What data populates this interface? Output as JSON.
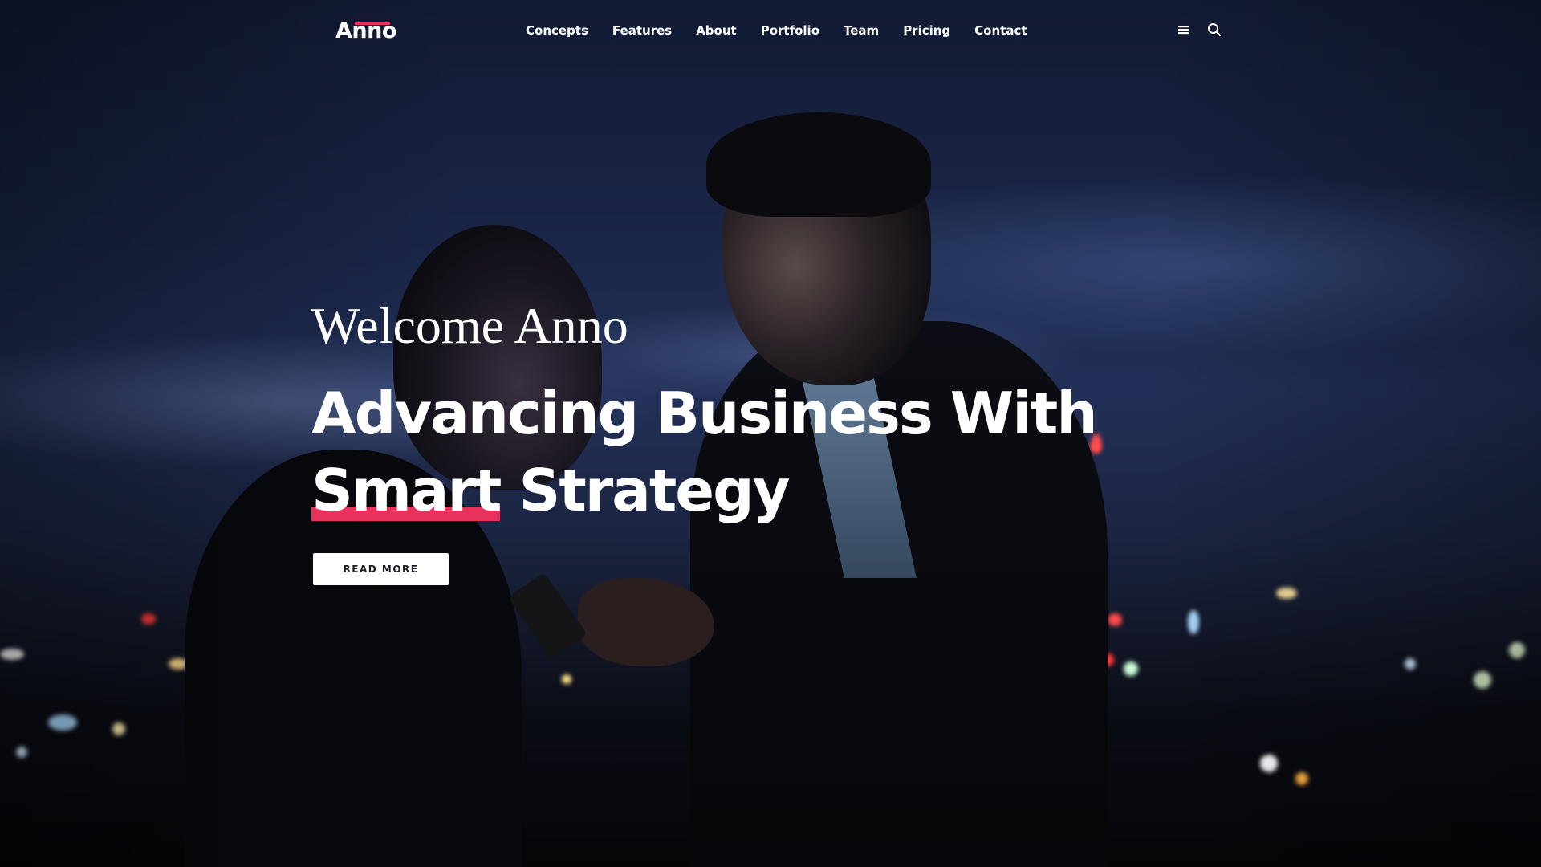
{
  "brand": {
    "logo_text": "Anno",
    "accent_color": "#e8315b"
  },
  "nav": {
    "items": [
      {
        "label": "Concepts"
      },
      {
        "label": "Features"
      },
      {
        "label": "About"
      },
      {
        "label": "Portfolio"
      },
      {
        "label": "Team"
      },
      {
        "label": "Pricing"
      },
      {
        "label": "Contact"
      }
    ],
    "icons": [
      "menu-icon",
      "search-icon"
    ]
  },
  "hero": {
    "eyebrow": "Welcome Anno",
    "title_line1": "Advancing Business With",
    "title_highlight": "Smart",
    "title_line2_rest": "Strategy",
    "cta_label": "READ MORE"
  }
}
